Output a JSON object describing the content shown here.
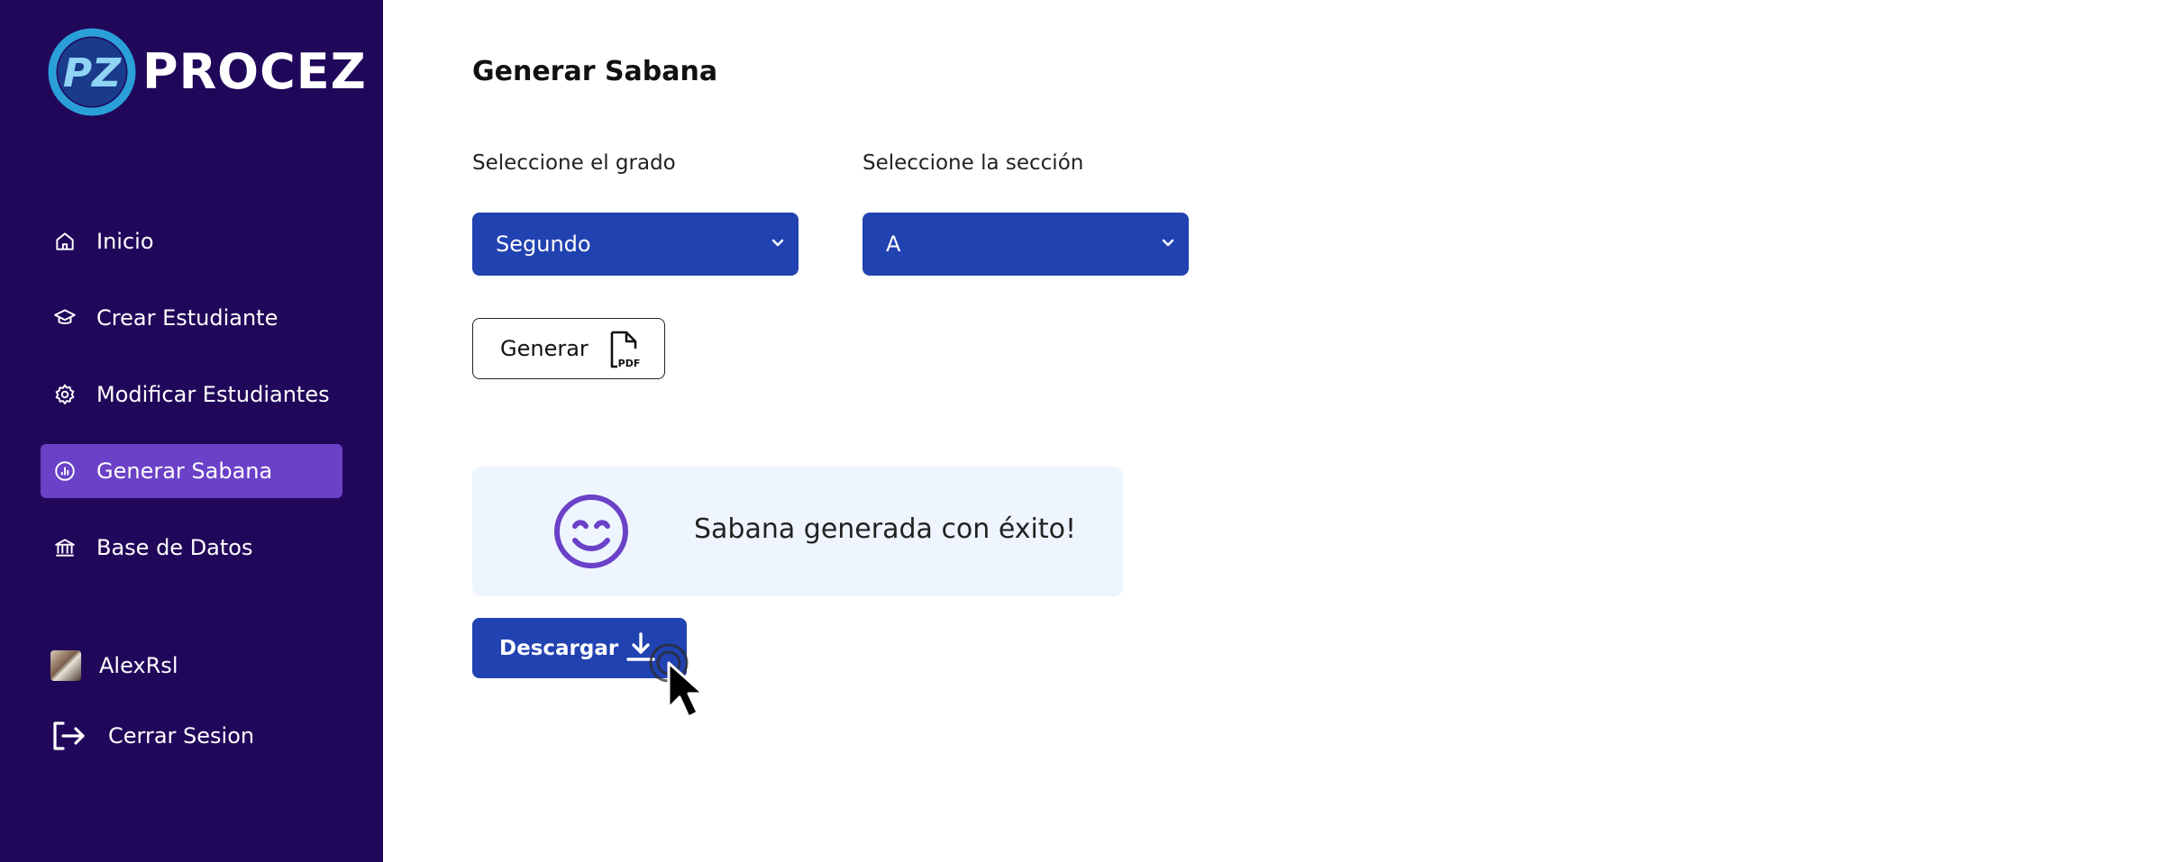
{
  "brand": {
    "name": "PROCEZ",
    "monogram": "PZ"
  },
  "sidebar": {
    "items": [
      {
        "label": "Inicio",
        "icon": "home-icon"
      },
      {
        "label": "Crear Estudiante",
        "icon": "graduation-cap-icon"
      },
      {
        "label": "Modificar Estudiantes",
        "icon": "gear-icon"
      },
      {
        "label": "Generar Sabana",
        "icon": "chart-icon",
        "active": true
      },
      {
        "label": "Base de Datos",
        "icon": "bank-icon"
      }
    ],
    "user": {
      "name": "AlexRsl"
    },
    "logout_label": "Cerrar Sesion"
  },
  "main": {
    "title": "Generar Sabana",
    "grade": {
      "label": "Seleccione el grado",
      "value": "Segundo"
    },
    "section": {
      "label": "Seleccione la sección",
      "value": "A"
    },
    "generate_label": "Generar",
    "alert": {
      "message": "Sabana generada con éxito!"
    },
    "download_label": "Descargar"
  },
  "colors": {
    "sidebar_bg": "#21075a",
    "active_item_bg": "#6a41c7",
    "primary_button": "#2142b1",
    "alert_bg": "#eef5fe",
    "smiley": "#6a41c7"
  }
}
